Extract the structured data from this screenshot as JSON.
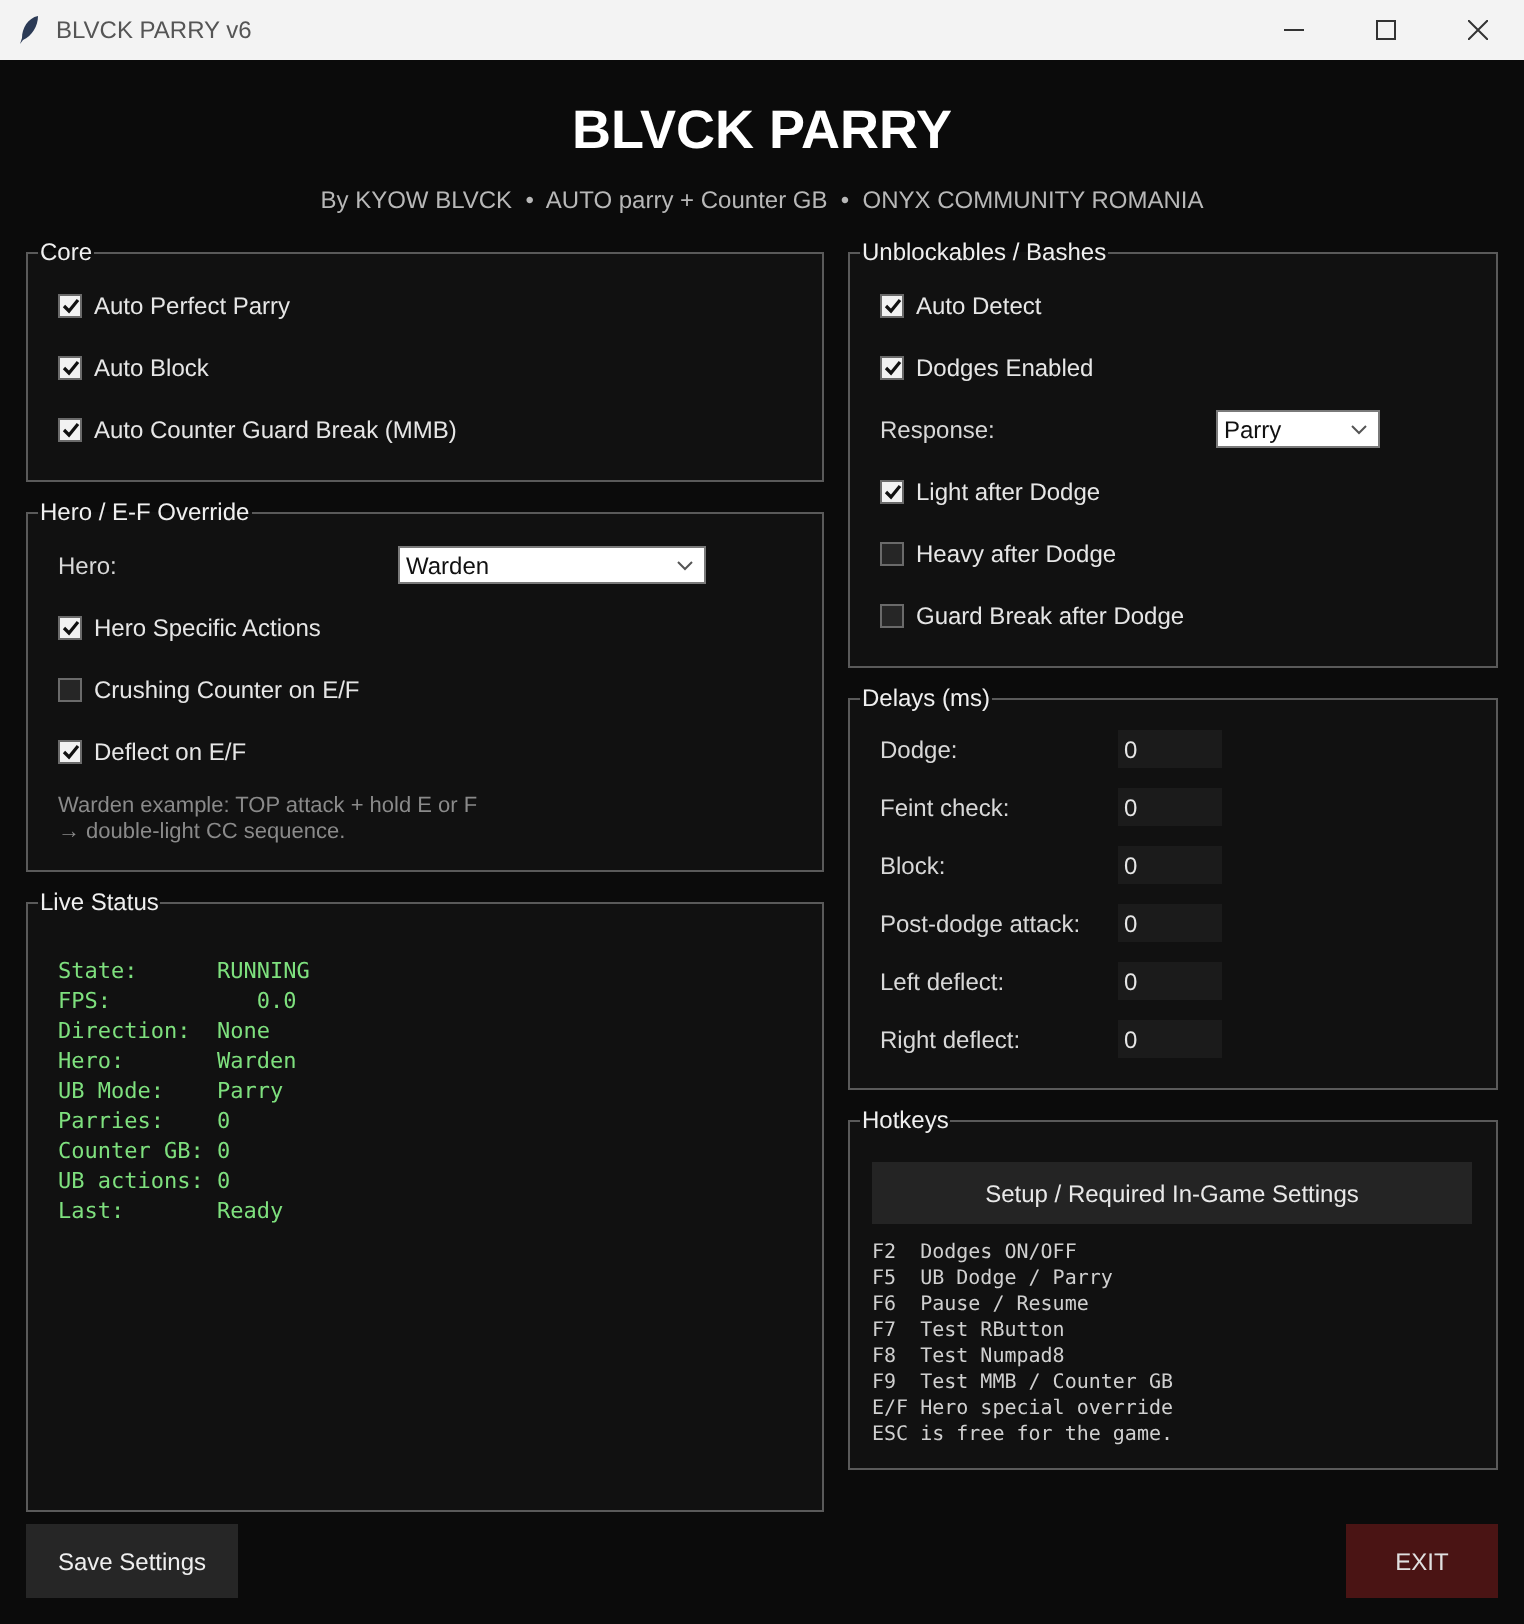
{
  "window": {
    "title": "BLVCK PARRY v6"
  },
  "header": {
    "title": "BLVCK PARRY",
    "subtitle": "By KYOW BLVCK  •  AUTO parry + Counter GB  •  ONYX COMMUNITY ROMANIA"
  },
  "core": {
    "title": "Core",
    "items": [
      {
        "kind": "checkbox",
        "label": "Auto Perfect Parry",
        "checked": true
      },
      {
        "kind": "checkbox",
        "label": "Auto Block",
        "checked": true
      },
      {
        "kind": "checkbox",
        "label": "Auto Counter Guard Break (MMB)",
        "checked": true
      }
    ]
  },
  "hero_override": {
    "title": "Hero / E-F Override",
    "items": [
      {
        "kind": "select",
        "label": "Hero:",
        "value": "Warden"
      },
      {
        "kind": "checkbox",
        "label": "Hero Specific Actions",
        "checked": true
      },
      {
        "kind": "checkbox",
        "label": "Crushing Counter on E/F",
        "checked": false
      },
      {
        "kind": "checkbox",
        "label": "Deflect on E/F",
        "checked": true
      },
      {
        "kind": "note",
        "lines": [
          "Warden example: TOP attack + hold E or F",
          "→ double-light CC sequence."
        ]
      }
    ]
  },
  "live_status": {
    "title": "Live Status",
    "lines": [
      {
        "label": "State:",
        "value": "RUNNING"
      },
      {
        "label": "FPS:",
        "value": "   0.0"
      },
      {
        "label": "Direction:",
        "value": "None"
      },
      {
        "label": "Hero:",
        "value": "Warden"
      },
      {
        "label": "UB Mode:",
        "value": "Parry"
      },
      {
        "label": "Parries:",
        "value": "0"
      },
      {
        "label": "Counter GB:",
        "value": "0"
      },
      {
        "label": "UB actions:",
        "value": "0"
      },
      {
        "label": "Last:",
        "value": "Ready"
      }
    ]
  },
  "unblockables": {
    "title": "Unblockables / Bashes",
    "items": [
      {
        "kind": "checkbox",
        "label": "Auto Detect",
        "checked": true
      },
      {
        "kind": "checkbox",
        "label": "Dodges Enabled",
        "checked": true
      },
      {
        "kind": "select",
        "label": "Response:",
        "value": "Parry"
      },
      {
        "kind": "checkbox",
        "label": "Light after Dodge",
        "checked": true
      },
      {
        "kind": "checkbox",
        "label": "Heavy after Dodge",
        "checked": false
      },
      {
        "kind": "checkbox",
        "label": "Guard Break after Dodge",
        "checked": false
      }
    ]
  },
  "delays": {
    "title": "Delays (ms)",
    "fields": [
      {
        "label": "Dodge:",
        "value": "0"
      },
      {
        "label": "Feint check:",
        "value": "0"
      },
      {
        "label": "Block:",
        "value": "0"
      },
      {
        "label": "Post-dodge attack:",
        "value": "0"
      },
      {
        "label": "Left deflect:",
        "value": "0"
      },
      {
        "label": "Right deflect:",
        "value": "0"
      }
    ]
  },
  "hotkeys": {
    "title": "Hotkeys",
    "button": "Setup / Required In-Game Settings",
    "lines": [
      "F2  Dodges ON/OFF",
      "F5  UB Dodge / Parry",
      "F6  Pause / Resume",
      "F7  Test RButton",
      "F8  Test Numpad8",
      "F9  Test MMB / Counter GB",
      "E/F Hero special override",
      "ESC is free for the game."
    ]
  },
  "buttons": {
    "save": "Save Settings",
    "exit": "EXIT"
  }
}
